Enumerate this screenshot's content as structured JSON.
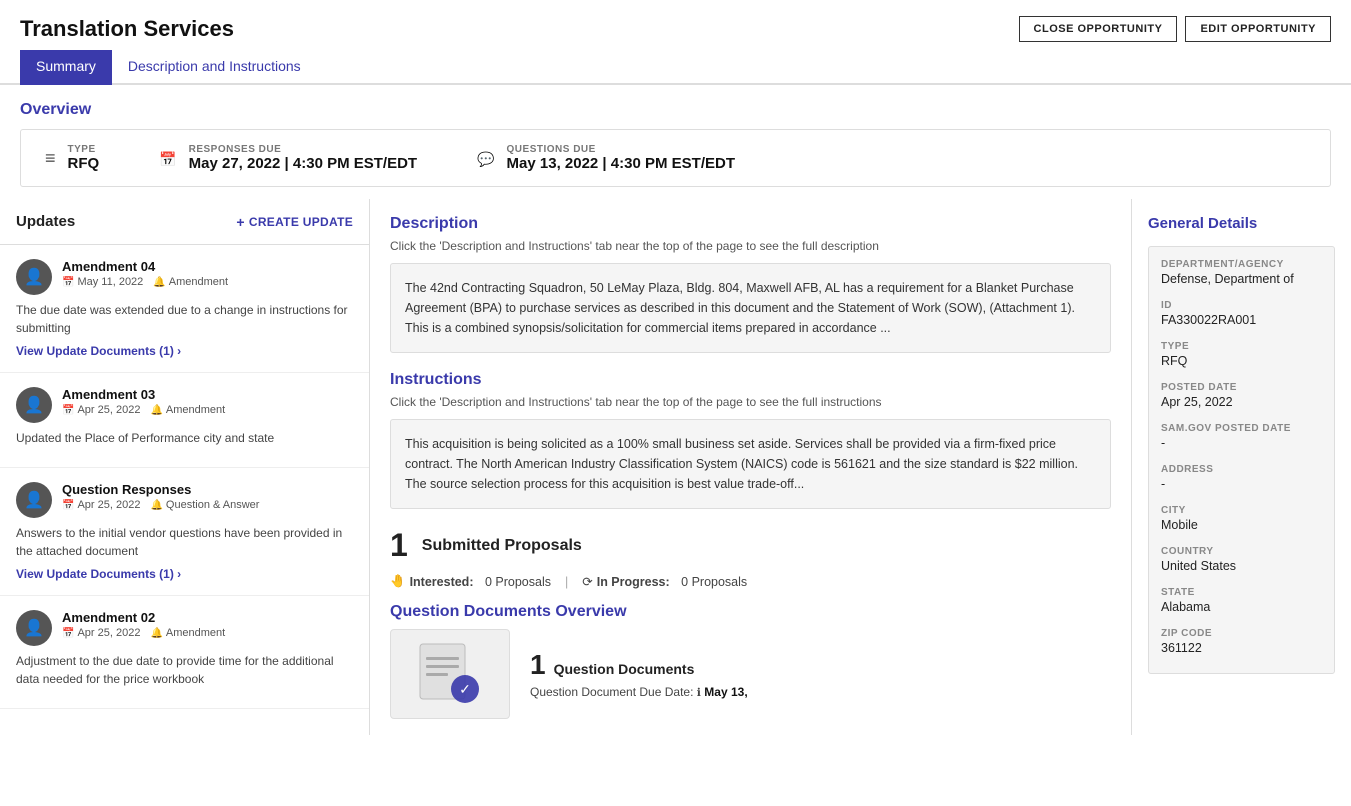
{
  "header": {
    "title": "Translation Services",
    "close_button": "CLOSE OPPORTUNITY",
    "edit_button": "EDIT OPPORTUNITY"
  },
  "tabs": [
    {
      "label": "Summary",
      "active": true
    },
    {
      "label": "Description and Instructions",
      "active": false
    }
  ],
  "overview": {
    "title": "Overview",
    "type_label": "TYPE",
    "type_value": "RFQ",
    "responses_due_label": "RESPONSES DUE",
    "responses_due_value": "May 27, 2022 | 4:30 PM EST/EDT",
    "questions_due_label": "QUESTIONS DUE",
    "questions_due_value": "May 13, 2022 | 4:30 PM EST/EDT"
  },
  "updates": {
    "title": "Updates",
    "create_update_label": "CREATE UPDATE",
    "items": [
      {
        "name": "Amendment 04",
        "date": "May 11, 2022",
        "type": "Amendment",
        "description": "The due date was extended due to a change in instructions for submitting",
        "view_docs_label": "View Update Documents (1)"
      },
      {
        "name": "Amendment 03",
        "date": "Apr 25, 2022",
        "type": "Amendment",
        "description": "Updated the Place of Performance city and state",
        "view_docs_label": null
      },
      {
        "name": "Question Responses",
        "date": "Apr 25, 2022",
        "type": "Question & Answer",
        "description": "Answers to the initial vendor questions have been provided in the attached document",
        "view_docs_label": "View Update Documents (1)"
      },
      {
        "name": "Amendment 02",
        "date": "Apr 25, 2022",
        "type": "Amendment",
        "description": "Adjustment to the due date to provide time for the additional data needed for the price workbook",
        "view_docs_label": null
      }
    ]
  },
  "description": {
    "heading": "Description",
    "subtext": "Click the 'Description and Instructions' tab near the top of the page to see the full description",
    "body": "The 42nd Contracting Squadron, 50 LeMay Plaza, Bldg. 804, Maxwell AFB, AL has a requirement for a Blanket Purchase Agreement (BPA) to purchase services as described in this document and the Statement of Work (SOW), (Attachment 1). This is a combined synopsis/solicitation for commercial items prepared in accordance ..."
  },
  "instructions": {
    "heading": "Instructions",
    "subtext": "Click the 'Description and Instructions' tab near the top of the page to see the full instructions",
    "body": "This acquisition is being solicited as a 100% small business set aside. Services shall be provided via a firm-fixed price contract. The North American Industry Classification System (NAICS) code is 561621 and the size standard is $22 million. The source selection process for this acquisition is best value trade-off..."
  },
  "submitted_proposals": {
    "count": "1",
    "label": "Submitted Proposals",
    "interested_label": "Interested:",
    "interested_count": "0 Proposals",
    "inprogress_label": "In Progress:",
    "inprogress_count": "0 Proposals"
  },
  "question_docs": {
    "heading": "Question Documents Overview",
    "count": "1",
    "label": "Question Documents",
    "due_label": "Question Document Due Date:",
    "due_value": "May 13,"
  },
  "general_details": {
    "title": "General Details",
    "items": [
      {
        "label": "DEPARTMENT/AGENCY",
        "value": "Defense, Department of"
      },
      {
        "label": "ID",
        "value": "FA330022RA001"
      },
      {
        "label": "TYPE",
        "value": "RFQ"
      },
      {
        "label": "POSTED DATE",
        "value": "Apr 25, 2022"
      },
      {
        "label": "SAM.gov POSTED DATE",
        "value": "-"
      },
      {
        "label": "ADDRESS",
        "value": "-"
      },
      {
        "label": "CITY",
        "value": "Mobile"
      },
      {
        "label": "COUNTRY",
        "value": "United States"
      },
      {
        "label": "STATE",
        "value": "Alabama"
      },
      {
        "label": "ZIP CODE",
        "value": "361122"
      }
    ]
  }
}
